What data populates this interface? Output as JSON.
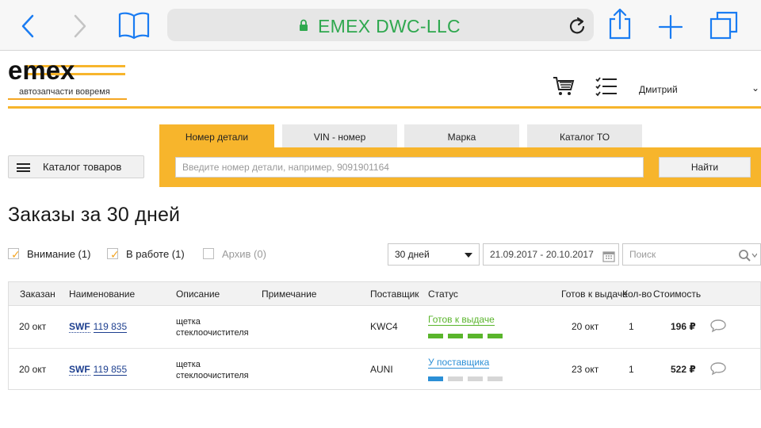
{
  "browser": {
    "url_text": "EMEX DWC-LLC",
    "icons": [
      "back-chevron-icon",
      "forward-chevron-icon",
      "bookmarks-book-icon",
      "lock-icon",
      "reload-icon",
      "share-icon",
      "plus-icon",
      "tabs-icon"
    ]
  },
  "header": {
    "logo_text": "emex",
    "tagline": "автозапчасти вовремя",
    "cart_icon": "cart-icon",
    "orders_icon": "checklist-icon",
    "user_name": "Дмитрий",
    "accent_color": "#f7b52c"
  },
  "search": {
    "tabs": [
      "Номер детали",
      "VIN - номер",
      "Марка",
      "Каталог ТО"
    ],
    "active_tab": 0,
    "placeholder": "Введите номер детали, например, 9091901164",
    "button": "Найти"
  },
  "catalog_button": "Каталог товаров",
  "page_title": "Заказы за 30 дней",
  "filters": {
    "attention": {
      "label": "Внимание (1)",
      "checked": true
    },
    "in_work": {
      "label": "В работе (1)",
      "checked": true
    },
    "archive": {
      "label": "Архив (0)",
      "checked": false
    },
    "period": "30 дней",
    "date_range": "21.09.2017 - 20.10.2017",
    "search_placeholder": "Поиск"
  },
  "table": {
    "headers": [
      "Заказан",
      "Наименование",
      "Описание",
      "Примечание",
      "Поставщик",
      "Статус",
      "Готов к выдаче",
      "Кол-во",
      "Стоимость"
    ],
    "rows": [
      {
        "ordered": "20 окт",
        "brand": "SWF",
        "part_number": "119 835",
        "description_line1": "щетка",
        "description_line2": "стеклоочистителя",
        "note": "",
        "supplier": "KWC4",
        "status": "Готов к выдаче",
        "status_color": "#5ab52c",
        "progress_steps_done": 4,
        "progress_steps_total": 4,
        "ready": "20 окт",
        "qty": "1",
        "cost": "196 ₽"
      },
      {
        "ordered": "20 окт",
        "brand": "SWF",
        "part_number": "119 855",
        "description_line1": "щетка",
        "description_line2": "стеклоочистителя",
        "note": "",
        "supplier": "AUNI",
        "status": "У поставщика",
        "status_color": "#2b8fd6",
        "progress_steps_done": 1,
        "progress_steps_total": 4,
        "ready": "23 окт",
        "qty": "1",
        "cost": "522 ₽"
      }
    ]
  }
}
